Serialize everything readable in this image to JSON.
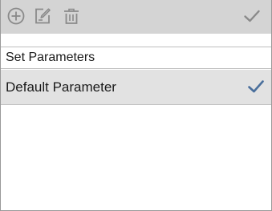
{
  "toolbar": {
    "buttons": [
      {
        "icon": "add-circle-icon"
      },
      {
        "icon": "edit-icon"
      },
      {
        "icon": "delete-icon"
      },
      {
        "icon": "checkmark-icon"
      }
    ],
    "background": "#d4d4d4",
    "icon_color": "#8a8a8a"
  },
  "section": {
    "title": "Set Parameters"
  },
  "parameters": {
    "items": [
      {
        "label": "Default Parameter",
        "selected": true
      }
    ],
    "selected_row_background": "#e2e2e2",
    "check_color": "#4a6f9c"
  }
}
